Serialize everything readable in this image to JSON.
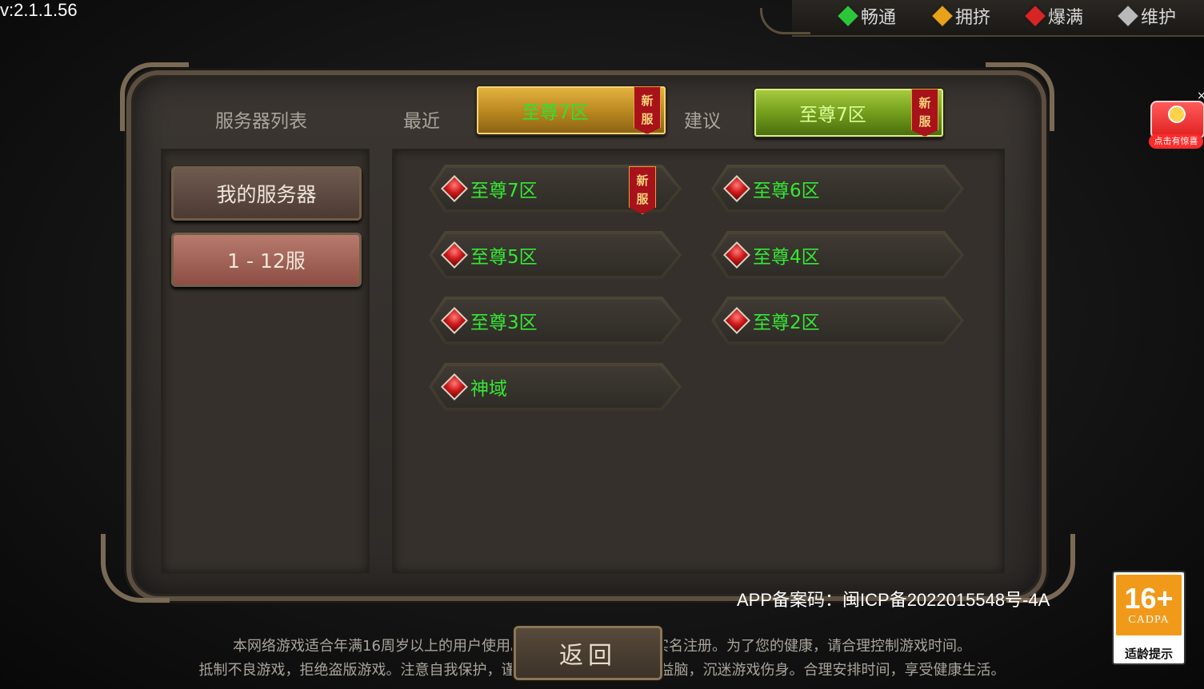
{
  "version": "v:2.1.1.56",
  "legend": [
    {
      "label": "畅通",
      "color": "#2ec43b"
    },
    {
      "label": "拥挤",
      "color": "#e8a21a"
    },
    {
      "label": "爆满",
      "color": "#d92424"
    },
    {
      "label": "维护",
      "color": "#b9b9b9"
    }
  ],
  "header": {
    "title": "服务器列表",
    "recent_label": "最近",
    "recent_server": "至尊7区",
    "suggest_label": "建议",
    "suggest_server": "至尊7区",
    "new_tag_line1": "新",
    "new_tag_line2": "服"
  },
  "sidebar": {
    "items": [
      {
        "label": "我的服务器"
      },
      {
        "label": "1 - 12服"
      }
    ]
  },
  "servers": [
    {
      "label": "至尊7区",
      "is_new": true
    },
    {
      "label": "至尊6区",
      "is_new": false
    },
    {
      "label": "至尊5区",
      "is_new": false
    },
    {
      "label": "至尊4区",
      "is_new": false
    },
    {
      "label": "至尊3区",
      "is_new": false
    },
    {
      "label": "至尊2区",
      "is_new": false
    },
    {
      "label": "神域",
      "is_new": false
    }
  ],
  "footer": {
    "icp": "APP备案码：闽ICP备2022015548号-4A",
    "back_label": "返回",
    "notice_line1": "本网络游戏适合年满16周岁以上的用户使用。请您确认已如实进行实名注册。为了您的健康，请合理控制游戏时间。",
    "notice_line2": "抵制不良游戏，拒绝盗版游戏。注意自我保护，谨防受骗上当。适度游戏益脑，沉迷游戏伤身。合理安排时间，享受健康生活。",
    "age_rating": "16+",
    "age_org": "CADPA",
    "age_tip": "适龄提示",
    "gift_caption": "点击有惊喜",
    "gift_close": "×"
  },
  "colors": {
    "server_text": "#34e834",
    "gold_button": "#d9a52f",
    "green_button": "#8ab52a",
    "active_tab": "#a8685c"
  }
}
